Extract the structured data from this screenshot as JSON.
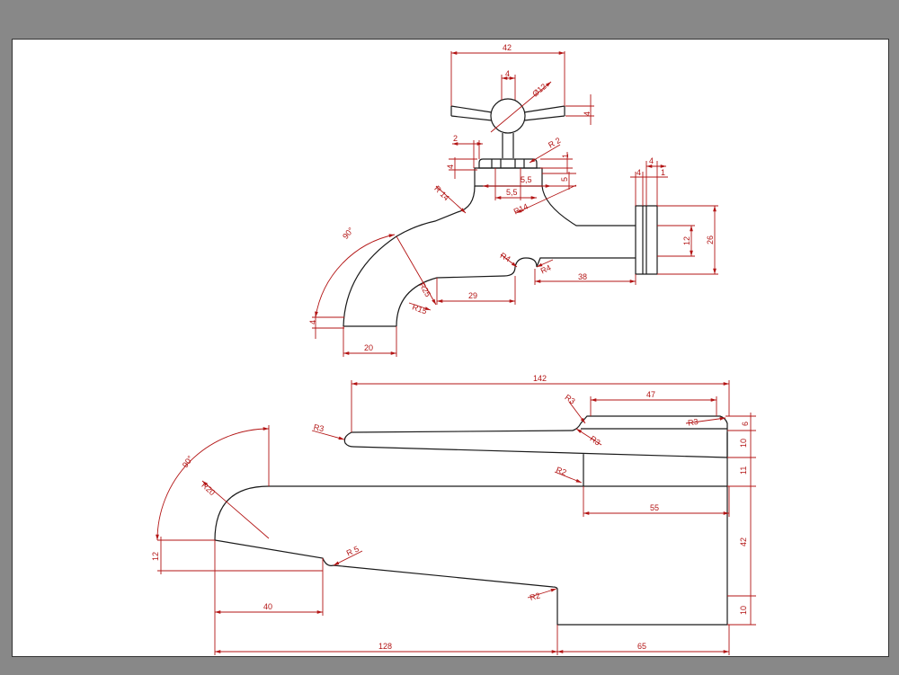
{
  "colors": {
    "background": "#888888",
    "sheet": "#ffffff",
    "outline": "#1a1a1a",
    "dimension": "#b31515"
  },
  "top_view": {
    "handle_width": "42",
    "stem_top": "4",
    "knob_diameter": "Ø12",
    "handle_thick": "4",
    "nut_left": "2",
    "nut_height": "4",
    "radius_r2": "R 2",
    "nut_right": "1",
    "nut_w1": "5,5",
    "nut_w2": "5,5",
    "nut_side": "5",
    "radius_r14_top": "R 14",
    "radius_r14": "R14",
    "flange_w": "4",
    "flange_a": "4",
    "flange_b": "1",
    "angle": "90°",
    "flange_inner": "12",
    "flange_outer": "26",
    "radius_r4a": "R4",
    "radius_r4b": "R4",
    "pipe_len": "38",
    "radius_r25": "R25",
    "seg_29": "29",
    "radius_r15": "R15",
    "spout_lip": "4",
    "spout_width": "20"
  },
  "side_view": {
    "total_top": "142",
    "cap_width": "47",
    "radius_r3_a": "R3",
    "radius_r3_b": "R3",
    "radius_r3_c": "R3",
    "radius_r3_d": "R3",
    "h6": "6",
    "h10a": "10",
    "radius_r2_a": "R2",
    "h11": "11",
    "angle": "90°",
    "radius_r20": "R20",
    "seg_55": "55",
    "h42": "42",
    "spout_12": "12",
    "radius_r5": "R 5",
    "seg_40": "40",
    "radius_r2_b": "R2",
    "h10b": "10",
    "seg_128": "128",
    "seg_65": "65"
  }
}
